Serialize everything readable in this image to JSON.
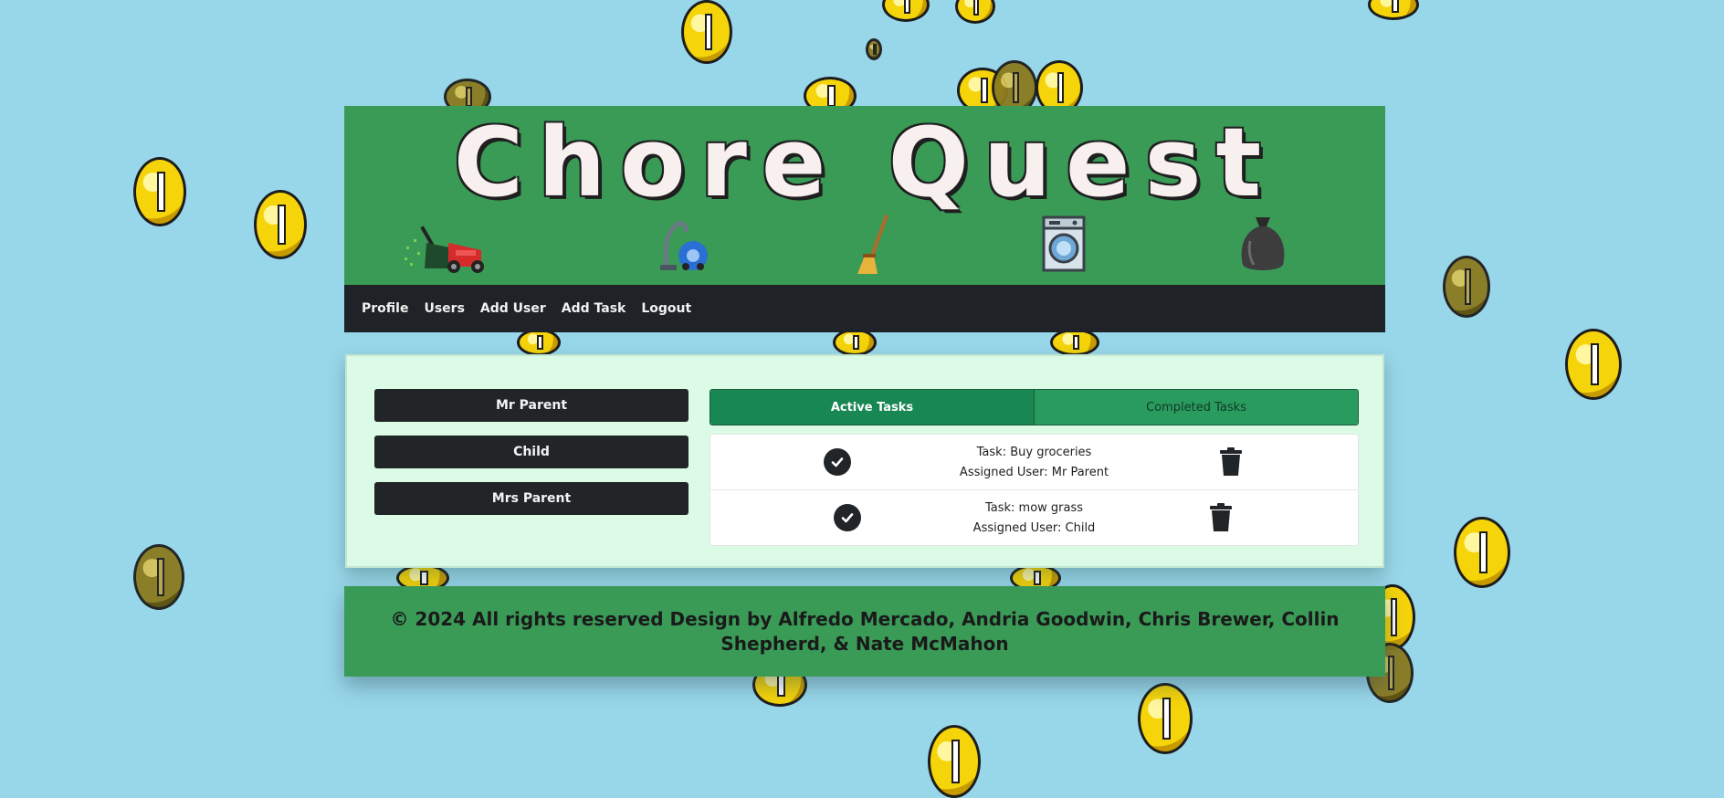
{
  "header": {
    "title": "Chore Quest",
    "icons": [
      "lawn-mower-icon",
      "vacuum-cleaner-icon",
      "broom-icon",
      "washing-machine-icon",
      "trash-bag-icon"
    ]
  },
  "nav": {
    "items": [
      {
        "label": "Profile"
      },
      {
        "label": "Users"
      },
      {
        "label": "Add User"
      },
      {
        "label": "Add Task"
      },
      {
        "label": "Logout"
      }
    ]
  },
  "users": [
    {
      "name": "Mr Parent"
    },
    {
      "name": "Child"
    },
    {
      "name": "Mrs Parent"
    }
  ],
  "tabs": {
    "active": "Active Tasks",
    "completed": "Completed Tasks"
  },
  "tasks": [
    {
      "task": "Task: Buy groceries",
      "assigned": "Assigned User: Mr Parent"
    },
    {
      "task": "Task: mow grass",
      "assigned": "Assigned User: Child"
    }
  ],
  "footer": {
    "text": "© 2024 All rights reserved Design by Alfredo Mercado, Andria Goodwin, Chris Brewer, Collin Shepherd, & Nate McMahon"
  },
  "colors": {
    "background": "#98d7ea",
    "brand_green": "#3a9b57",
    "nav_dark": "#1f2226",
    "active_tab": "#188754",
    "card_bg": "#dcfbe7"
  }
}
